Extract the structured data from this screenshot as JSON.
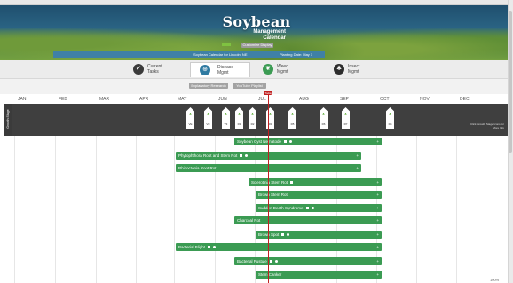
{
  "header": {
    "logo_main": "Soybean",
    "logo_sub1": "Management",
    "logo_sub2": "Calendar",
    "small_btn": "Customize Display"
  },
  "infobar": {
    "calendar_for": "Soybean Calendar for Lincoln, NE",
    "planting_date": "Planting Date: May 1"
  },
  "tabs": [
    {
      "label1": "Current",
      "label2": "Tasks",
      "icon": "check-icon",
      "color": "#3a3a3a"
    },
    {
      "label1": "Disease",
      "label2": "Mgmt",
      "icon": "target-icon",
      "color": "#2f7aa1"
    },
    {
      "label1": "Weed",
      "label2": "Mgmt",
      "icon": "leaf-icon",
      "color": "#3b9b53"
    },
    {
      "label1": "Insect",
      "label2": "Mgmt",
      "icon": "bug-icon",
      "color": "#2c2c2c"
    }
  ],
  "toolbar": {
    "btn1": "Explanatory Research",
    "btn2": "YouTube Playlist"
  },
  "months": [
    "JAN",
    "FEB",
    "MAR",
    "APR",
    "MAY",
    "JUN",
    "JUL",
    "AUG",
    "SEP",
    "OCT",
    "NOV",
    "DEC"
  ],
  "stage_label": "Growth Stage",
  "stages": [
    "VE",
    "VC",
    "V3",
    "R1",
    "R2",
    "R3",
    "R5",
    "R6",
    "R7",
    "R8"
  ],
  "cta": "Click Growth Stage Icons for More Info",
  "today_label": "Today",
  "diseases": [
    {
      "name": "Soybean Cyst Nematode",
      "icons": 2
    },
    {
      "name": "Phytophthora Root and Stem Rot",
      "icons": 2
    },
    {
      "name": "Rhizoctonia Root Rot",
      "icons": 0
    },
    {
      "name": "Sclerotinia Stem Rot",
      "icons": 1
    },
    {
      "name": "Brown Stem Rot",
      "icons": 0
    },
    {
      "name": "Sudden Death Syndrome",
      "icons": 2
    },
    {
      "name": "Charcoal Rot",
      "icons": 0
    },
    {
      "name": "Brown Spot",
      "icons": 2
    },
    {
      "name": "Bacterial Blight",
      "icons": 2
    },
    {
      "name": "Bacterial Pustule",
      "icons": 2
    },
    {
      "name": "Stem Canker",
      "icons": 0
    }
  ],
  "plus": "+",
  "zoom": "100%"
}
